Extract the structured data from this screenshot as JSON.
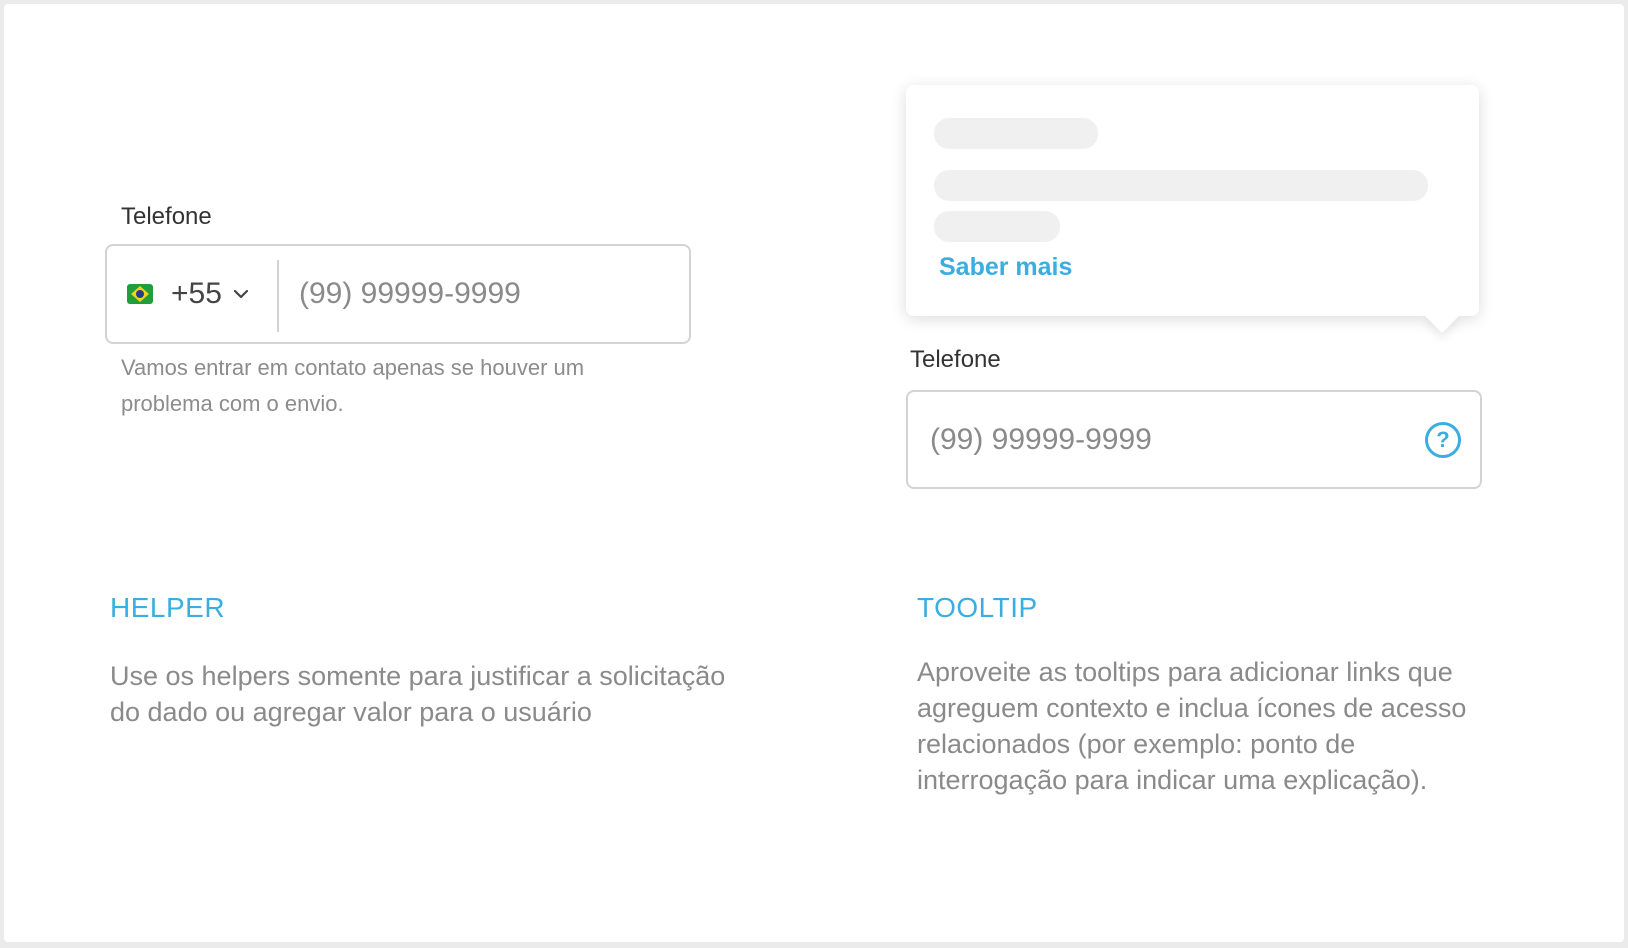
{
  "colors": {
    "accent": "#3aaee0",
    "border": "#d3d3d3",
    "skeleton": "#f0f0f0"
  },
  "helper_example": {
    "label": "Telefone",
    "country_flag": "brazil-flag-icon",
    "country_code": "+55",
    "placeholder": "(99) 99999-9999",
    "helper_text": "Vamos entrar em contato apenas se houver um problema com o envio."
  },
  "tooltip_example": {
    "tooltip": {
      "link_label": "Saber mais"
    },
    "label": "Telefone",
    "placeholder": "(99) 99999-9999",
    "help_icon": "question-circle-icon",
    "help_glyph": "?"
  },
  "sections": {
    "helper": {
      "title": "HELPER",
      "description": "Use os helpers somente para justificar a solicitação do dado ou agregar valor para o usuário"
    },
    "tooltip": {
      "title": "TOOLTIP",
      "description": "Aproveite as tooltips para adicionar links que agreguem contexto e inclua ícones de acesso relacionados (por exemplo: ponto de interrogação para indicar uma explicação)."
    }
  }
}
